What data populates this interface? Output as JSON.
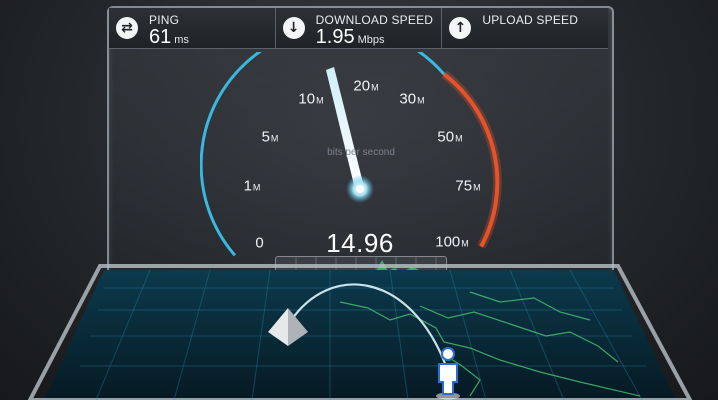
{
  "stats": {
    "ping": {
      "label": "PING",
      "value": "61",
      "unit": "ms",
      "icon": "swap-arrows-icon"
    },
    "download": {
      "label": "DOWNLOAD SPEED",
      "value": "1.95",
      "unit": "Mbps",
      "icon": "arrow-down-icon"
    },
    "upload": {
      "label": "UPLOAD SPEED",
      "icon": "arrow-up-icon"
    }
  },
  "gauge": {
    "caption": "bits per second",
    "readout": "14.96",
    "ticks": [
      {
        "num": "0",
        "suf": ""
      },
      {
        "num": "1",
        "suf": "M"
      },
      {
        "num": "5",
        "suf": "M"
      },
      {
        "num": "10",
        "suf": "M"
      },
      {
        "num": "20",
        "suf": "M"
      },
      {
        "num": "30",
        "suf": "M"
      },
      {
        "num": "50",
        "suf": "M"
      },
      {
        "num": "75",
        "suf": "M"
      },
      {
        "num": "100",
        "suf": "M"
      }
    ],
    "colors": {
      "arc": "#3ab8e0",
      "hot": "#e4532a",
      "needle": "#ffffff"
    }
  }
}
